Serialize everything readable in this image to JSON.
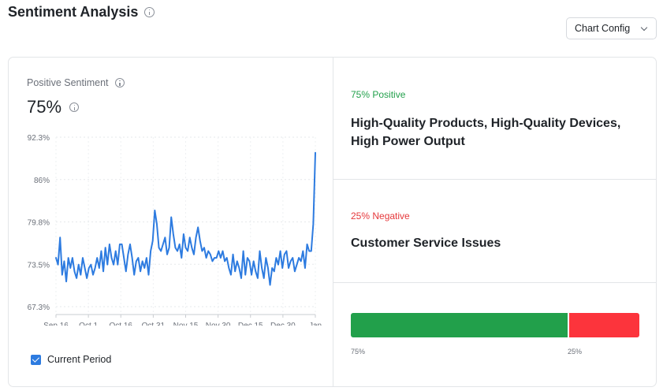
{
  "header": {
    "title": "Sentiment Analysis",
    "config_button": "Chart Config"
  },
  "metric": {
    "label": "Positive Sentiment",
    "value": "75%"
  },
  "legend": {
    "label": "Current Period",
    "checked": true,
    "color": "#2d7be0"
  },
  "chart_data": {
    "type": "line",
    "x_tick_labels": [
      "Sep 16",
      "Oct 1",
      "Oct 16",
      "Oct 31",
      "Nov 15",
      "Nov 30",
      "Dec 15",
      "Dec 30",
      "Jan"
    ],
    "y_tick_labels": [
      "92.3%",
      "86%",
      "79.8%",
      "73.5%",
      "67.3%"
    ],
    "ylim": [
      67.3,
      92.3
    ],
    "grid": true,
    "series": [
      {
        "color": "#2d7be0",
        "values": [
          74.5,
          73.5,
          77.5,
          72.0,
          74.0,
          71.0,
          74.5,
          73.0,
          74.5,
          72.5,
          71.5,
          73.5,
          72.0,
          74.5,
          73.0,
          71.5,
          73.0,
          73.5,
          72.0,
          73.0,
          74.5,
          73.0,
          75.5,
          72.5,
          76.0,
          73.5,
          76.5,
          74.5,
          73.5,
          75.5,
          73.5,
          76.5,
          76.5,
          74.5,
          72.5,
          75.0,
          76.5,
          74.5,
          72.0,
          74.0,
          74.5,
          72.5,
          74.0,
          73.0,
          74.5,
          72.0,
          75.5,
          77.0,
          81.5,
          79.5,
          76.0,
          75.5,
          76.5,
          77.5,
          75.0,
          76.0,
          80.5,
          78.0,
          76.0,
          75.5,
          76.5,
          74.5,
          78.0,
          76.0,
          75.5,
          77.5,
          76.0,
          75.0,
          77.5,
          79.0,
          77.0,
          75.5,
          76.0,
          74.5,
          75.5,
          75.0,
          74.0,
          74.5,
          74.5,
          75.5,
          74.5,
          75.5,
          74.0,
          74.5,
          73.0,
          72.0,
          75.0,
          72.5,
          74.0,
          73.0,
          71.5,
          75.5,
          72.0,
          74.5,
          74.0,
          72.0,
          74.0,
          72.5,
          71.5,
          75.5,
          73.0,
          71.5,
          74.5,
          73.0,
          70.5,
          73.0,
          72.5,
          74.5,
          73.5,
          75.5,
          73.0,
          75.0,
          75.5,
          73.0,
          74.0,
          74.5,
          72.5,
          73.5,
          74.5,
          74.0,
          75.5,
          73.0,
          76.5,
          75.5,
          75.5,
          79.5,
          90.0
        ]
      }
    ]
  },
  "insights": {
    "positive": {
      "tag": "75% Positive",
      "headline": "High-Quality Products, High-Quality Devices, High Power Output",
      "color": "#22a04b"
    },
    "negative": {
      "tag": "25% Negative",
      "headline": "Customer Service Issues",
      "color": "#e5383b"
    }
  },
  "split_bar": {
    "positive_fraction": 0.75,
    "negative_fraction": 0.25,
    "positive_label": "75%",
    "negative_label": "25%",
    "positive_color": "#22a04b",
    "negative_color": "#fc343c"
  }
}
